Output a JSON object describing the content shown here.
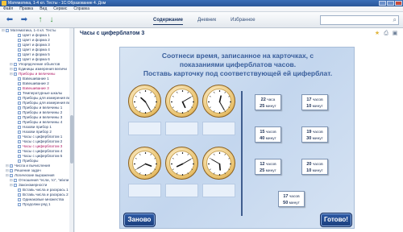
{
  "window": {
    "title": "Математика, 1-4 кл. Тесты - 1С:Образование 4. Дом"
  },
  "menu": [
    "Файл",
    "Правка",
    "Вид",
    "Сервис",
    "Справка"
  ],
  "tabs": [
    {
      "label": "Содержание",
      "active": true
    },
    {
      "label": "Дневник",
      "active": false
    },
    {
      "label": "Избранное",
      "active": false
    }
  ],
  "search": {
    "value": "",
    "placeholder": ""
  },
  "sidebar": {
    "items": [
      {
        "label": "Математика, 1-4 кл. Тесты",
        "depth": 0,
        "kind": "folder",
        "selected": false
      },
      {
        "label": "Цвет и форма 1",
        "depth": 3,
        "kind": "doc",
        "selected": false
      },
      {
        "label": "Цвет и форма 2",
        "depth": 3,
        "kind": "doc",
        "selected": false
      },
      {
        "label": "Цвет и форма 3",
        "depth": 3,
        "kind": "doc",
        "selected": false
      },
      {
        "label": "Цвет и форма 4",
        "depth": 3,
        "kind": "doc",
        "selected": false
      },
      {
        "label": "Цвет и форма 5",
        "depth": 3,
        "kind": "doc",
        "selected": false
      },
      {
        "label": "Цвет и форма 6",
        "depth": 3,
        "kind": "doc",
        "selected": false
      },
      {
        "label": "Упорядочение объектов",
        "depth": 2,
        "kind": "folder",
        "selected": false
      },
      {
        "label": "Единицы измерения величи",
        "depth": 2,
        "kind": "folder",
        "selected": false
      },
      {
        "label": "Приборы и величины",
        "depth": 2,
        "kind": "folder",
        "selected": true
      },
      {
        "label": "Взвешивание 1",
        "depth": 3,
        "kind": "doc",
        "selected": false
      },
      {
        "label": "Взвешивание 2",
        "depth": 3,
        "kind": "doc",
        "selected": false
      },
      {
        "label": "Взвешивание 3",
        "depth": 3,
        "kind": "doc",
        "selected": true
      },
      {
        "label": "Температурные шкалы",
        "depth": 3,
        "kind": "doc",
        "selected": false
      },
      {
        "label": "Приборы для измерения ве",
        "depth": 3,
        "kind": "doc",
        "selected": false
      },
      {
        "label": "Приборы для измерения ве",
        "depth": 3,
        "kind": "doc",
        "selected": false
      },
      {
        "label": "Приборы и величины 1",
        "depth": 3,
        "kind": "doc",
        "selected": false
      },
      {
        "label": "Приборы и величины 2",
        "depth": 3,
        "kind": "doc",
        "selected": false
      },
      {
        "label": "Приборы и величины 3",
        "depth": 3,
        "kind": "doc",
        "selected": false
      },
      {
        "label": "Приборы и величины 4",
        "depth": 3,
        "kind": "doc",
        "selected": false
      },
      {
        "label": "Назови прибор 1",
        "depth": 3,
        "kind": "doc",
        "selected": false
      },
      {
        "label": "Назови прибор 2",
        "depth": 3,
        "kind": "doc",
        "selected": false
      },
      {
        "label": "Часы с циферблатом 1",
        "depth": 3,
        "kind": "doc",
        "selected": false
      },
      {
        "label": "Часы с циферблатом 2",
        "depth": 3,
        "kind": "doc",
        "selected": false
      },
      {
        "label": "Часы с циферблатом 3",
        "depth": 3,
        "kind": "doc",
        "selected": true
      },
      {
        "label": "Часы с циферблатом 4",
        "depth": 3,
        "kind": "doc",
        "selected": false
      },
      {
        "label": "Часы с циферблатом 5",
        "depth": 3,
        "kind": "doc",
        "selected": false
      },
      {
        "label": "Приборы",
        "depth": 3,
        "kind": "doc",
        "selected": false
      },
      {
        "label": "Числа и вычисления",
        "depth": 1,
        "kind": "folder",
        "selected": false
      },
      {
        "label": "Решение задач",
        "depth": 1,
        "kind": "folder",
        "selected": false
      },
      {
        "label": "Логические выражения",
        "depth": 1,
        "kind": "folder",
        "selected": false
      },
      {
        "label": "Отношения \"если, то\", \"и/или",
        "depth": 2,
        "kind": "folder",
        "selected": false
      },
      {
        "label": "Закономерности",
        "depth": 2,
        "kind": "folder",
        "selected": false
      },
      {
        "label": "Вставь числа и раскрась 1",
        "depth": 3,
        "kind": "doc",
        "selected": false
      },
      {
        "label": "Вставь числа и раскрась 2",
        "depth": 3,
        "kind": "doc",
        "selected": false
      },
      {
        "label": "Одинаковые множества",
        "depth": 3,
        "kind": "doc",
        "selected": false
      },
      {
        "label": "Продолжи ряд 1",
        "depth": 3,
        "kind": "doc",
        "selected": false
      }
    ]
  },
  "page": {
    "title": "Часы с циферблатом 3"
  },
  "exercise": {
    "instruction_line1": "Соотнеси время, записанное на карточках, с",
    "instruction_line2": "показаниями циферблатов часов.",
    "instruction_line3": "Поставь карточку под соответствующей ей циферблат.",
    "clocks": [
      {
        "hour": 22,
        "minute": 25
      },
      {
        "hour": 17,
        "minute": 10
      },
      {
        "hour": 12,
        "minute": 25
      },
      {
        "hour": 15,
        "minute": 40
      },
      {
        "hour": 20,
        "minute": 10
      },
      {
        "hour": 17,
        "minute": 50
      }
    ],
    "cards": [
      {
        "hours": "22",
        "hours_word": "часа",
        "minutes": "25",
        "minutes_word": "минут"
      },
      {
        "hours": "17",
        "hours_word": "часов",
        "minutes": "10",
        "minutes_word": "минут"
      },
      {
        "hours": "15",
        "hours_word": "часов",
        "minutes": "40",
        "minutes_word": "минут"
      },
      {
        "hours": "19",
        "hours_word": "часов",
        "minutes": "30",
        "minutes_word": "минут"
      },
      {
        "hours": "12",
        "hours_word": "часов",
        "minutes": "25",
        "minutes_word": "минут"
      },
      {
        "hours": "20",
        "hours_word": "часов",
        "minutes": "10",
        "minutes_word": "минут"
      },
      {
        "hours": "17",
        "hours_word": "часов",
        "minutes": "50",
        "minutes_word": "минут"
      }
    ],
    "reset_label": "Заново",
    "done_label": "Готово!"
  },
  "colors": {
    "accent": "#1b3e7c",
    "selected_text": "#b01a66",
    "board": "#c9daef"
  }
}
